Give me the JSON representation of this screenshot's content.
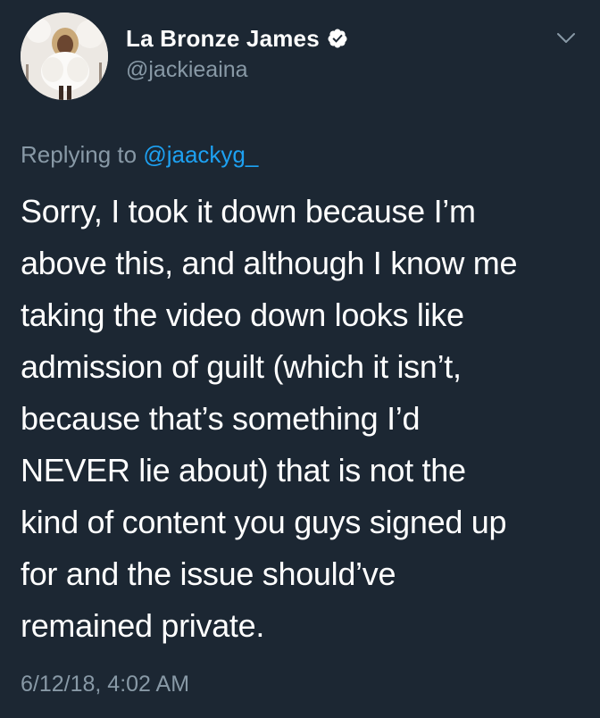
{
  "tweet": {
    "author": {
      "display_name": "La Bronze James",
      "handle": "@jackieaina",
      "verified": true,
      "avatar_icon": "profile-photo"
    },
    "menu_icon": "chevron-down-icon",
    "reply": {
      "prefix": "Replying to",
      "mention": "@jaackyg_"
    },
    "text_lines": [
      "Sorry, I took it down because I’m",
      "above this, and although I know me",
      "taking the video down looks like",
      "admission of guilt (which it isn’t,",
      "because that’s something I’d",
      "NEVER lie about) that is not the",
      "kind of content you guys signed up",
      "for and the issue should’ve",
      "remained private."
    ],
    "timestamp": "6/12/18, 4:02 AM"
  },
  "colors": {
    "background": "#1c2733",
    "text_primary": "#ffffff",
    "text_secondary": "#8899a6",
    "link": "#1da1f2"
  }
}
